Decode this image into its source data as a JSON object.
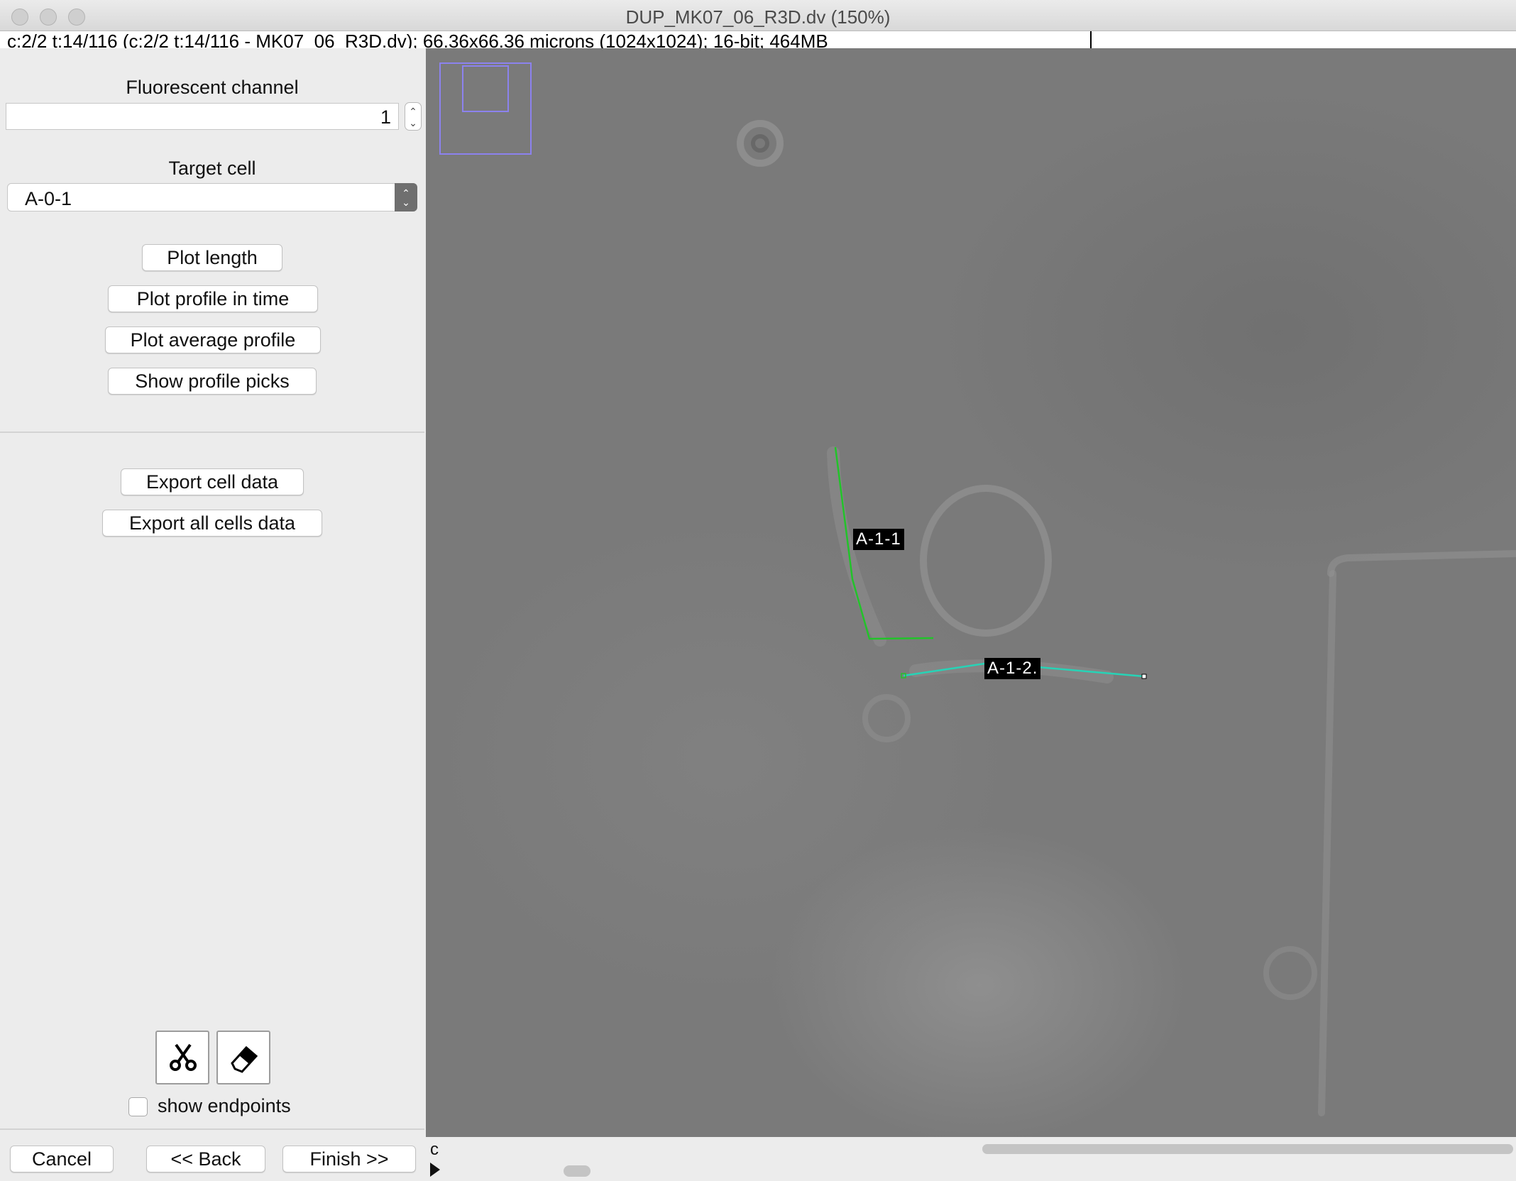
{
  "window": {
    "title": "DUP_MK07_06_R3D.dv (150%)"
  },
  "infobar": {
    "text": "c:2/2 t:14/116 (c:2/2 t:14/116 - MK07_06_R3D.dv); 66.36x66.36 microns (1024x1024); 16-bit; 464MB"
  },
  "panel": {
    "fluorescent_label": "Fluorescent channel",
    "fluorescent_value": "1",
    "target_label": "Target cell",
    "target_value": "A-0-1",
    "buttons": {
      "plot_length": "Plot length",
      "plot_profile_time": "Plot profile in time",
      "plot_average_profile": "Plot average profile",
      "show_profile_picks": "Show profile picks",
      "export_cell_data": "Export cell data",
      "export_all_cells_data": "Export all cells data"
    },
    "tools": [
      "scissors-icon",
      "eraser-icon"
    ],
    "show_endpoints_label": "show endpoints",
    "show_endpoints_checked": false
  },
  "footer": {
    "cancel": "Cancel",
    "back": "<< Back",
    "finish": "Finish >>"
  },
  "canvas": {
    "cells": [
      {
        "label": "A-1-1",
        "color": "#22c32a"
      },
      {
        "label": "A-1-2.",
        "color": "#27d3b6"
      }
    ]
  },
  "scrollbar": {
    "channel_letter": "c"
  }
}
